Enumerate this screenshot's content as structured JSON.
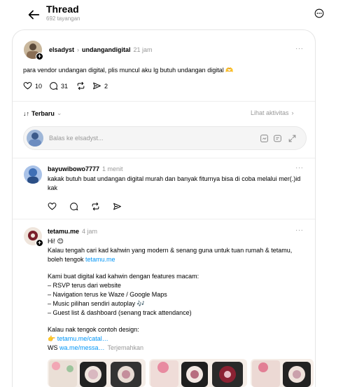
{
  "header": {
    "title": "Thread",
    "views": "692 tayangan"
  },
  "main_post": {
    "username": "elsadyst",
    "reply_to": "undangandigital",
    "time": "21 jam",
    "text": "para vendor undangan digital, plis muncul aku lg butuh undangan digital 🫶",
    "likes": "10",
    "comments": "31",
    "shares": "2"
  },
  "sort": {
    "label": "Terbaru",
    "activity_link": "Lihat aktivitas"
  },
  "reply_input": {
    "placeholder": "Balas ke elsadyst..."
  },
  "replies": [
    {
      "username": "bayuwibowo7777",
      "time": "1 menit",
      "text": "kakak butuh buat undangan digital murah dan banyak fiturnya bisa di coba melalui mer(.)id kak"
    },
    {
      "username": "tetamu.me",
      "time": "4 jam",
      "greeting": "Hi! 😊",
      "line1": "Kalau tengah cari kad kahwin yang modern & senang guna untuk tuan rumah & tetamu, boleh tengok ",
      "link1": "tetamu.me",
      "intro": "Kami buat digital kad kahwin dengan features macam:",
      "features": [
        "– RSVP terus dari website",
        "– Navigation terus ke Waze / Google Maps",
        "– Music pilihan sendiri autoplay 🎶",
        "– Guest list & dashboard (senang track attendance)"
      ],
      "design_label": "Kalau nak tengok contoh design:",
      "design_link": "tetamu.me/catal…",
      "ws_label": "WS ",
      "ws_link": "wa.me/messa…",
      "translate": "Terjemahkan"
    }
  ],
  "icons": [
    "back-arrow-icon",
    "more-options-icon",
    "heart-icon",
    "comment-icon",
    "repost-icon",
    "share-icon",
    "gif-icon",
    "poll-icon",
    "expand-icon"
  ],
  "colors": {
    "link": "#0095f6",
    "muted": "#999999",
    "border": "#e5e5e5"
  }
}
